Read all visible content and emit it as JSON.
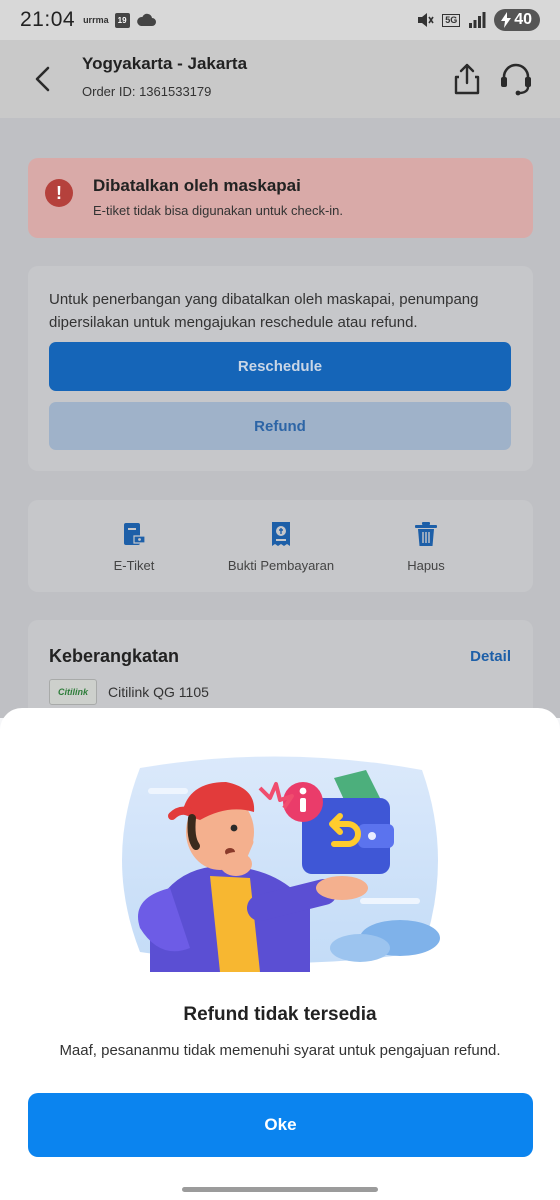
{
  "status_bar": {
    "time": "21:04",
    "carrier_mini": "urrma",
    "calendar_day": "19",
    "network": "5G",
    "battery": "40"
  },
  "header": {
    "title": "Yogyakarta - Jakarta",
    "order_id": "Order ID: 1361533179",
    "icons": [
      "back-arrow-icon",
      "share-icon",
      "customer-support-icon"
    ]
  },
  "alert": {
    "title": "Dibatalkan oleh maskapai",
    "subtitle": "E-tiket tidak bisa digunakan untuk check-in.",
    "icon": "!",
    "color": "#b5413c"
  },
  "options_card": {
    "message": "Untuk penerbangan yang dibatalkan oleh maskapai, penumpang dipersilakan untuk mengajukan reschedule atau refund.",
    "reschedule_label": "Reschedule",
    "refund_label": "Refund"
  },
  "actions": [
    {
      "label": "E-Tiket",
      "icon": "ticket-icon"
    },
    {
      "label": "Bukti Pembayaran",
      "icon": "receipt-icon"
    },
    {
      "label": "Hapus",
      "icon": "trash-icon"
    }
  ],
  "departure": {
    "title": "Keberangkatan",
    "detail_link": "Detail",
    "airline_logo_text": "Citilink",
    "flight": "Citilink QG 1105"
  },
  "sheet": {
    "title": "Refund tidak tersedia",
    "message": "Maaf, pesananmu tidak memenuhi syarat untuk pengajuan refund.",
    "button_label": "Oke",
    "accent_color": "#0b84ef"
  }
}
